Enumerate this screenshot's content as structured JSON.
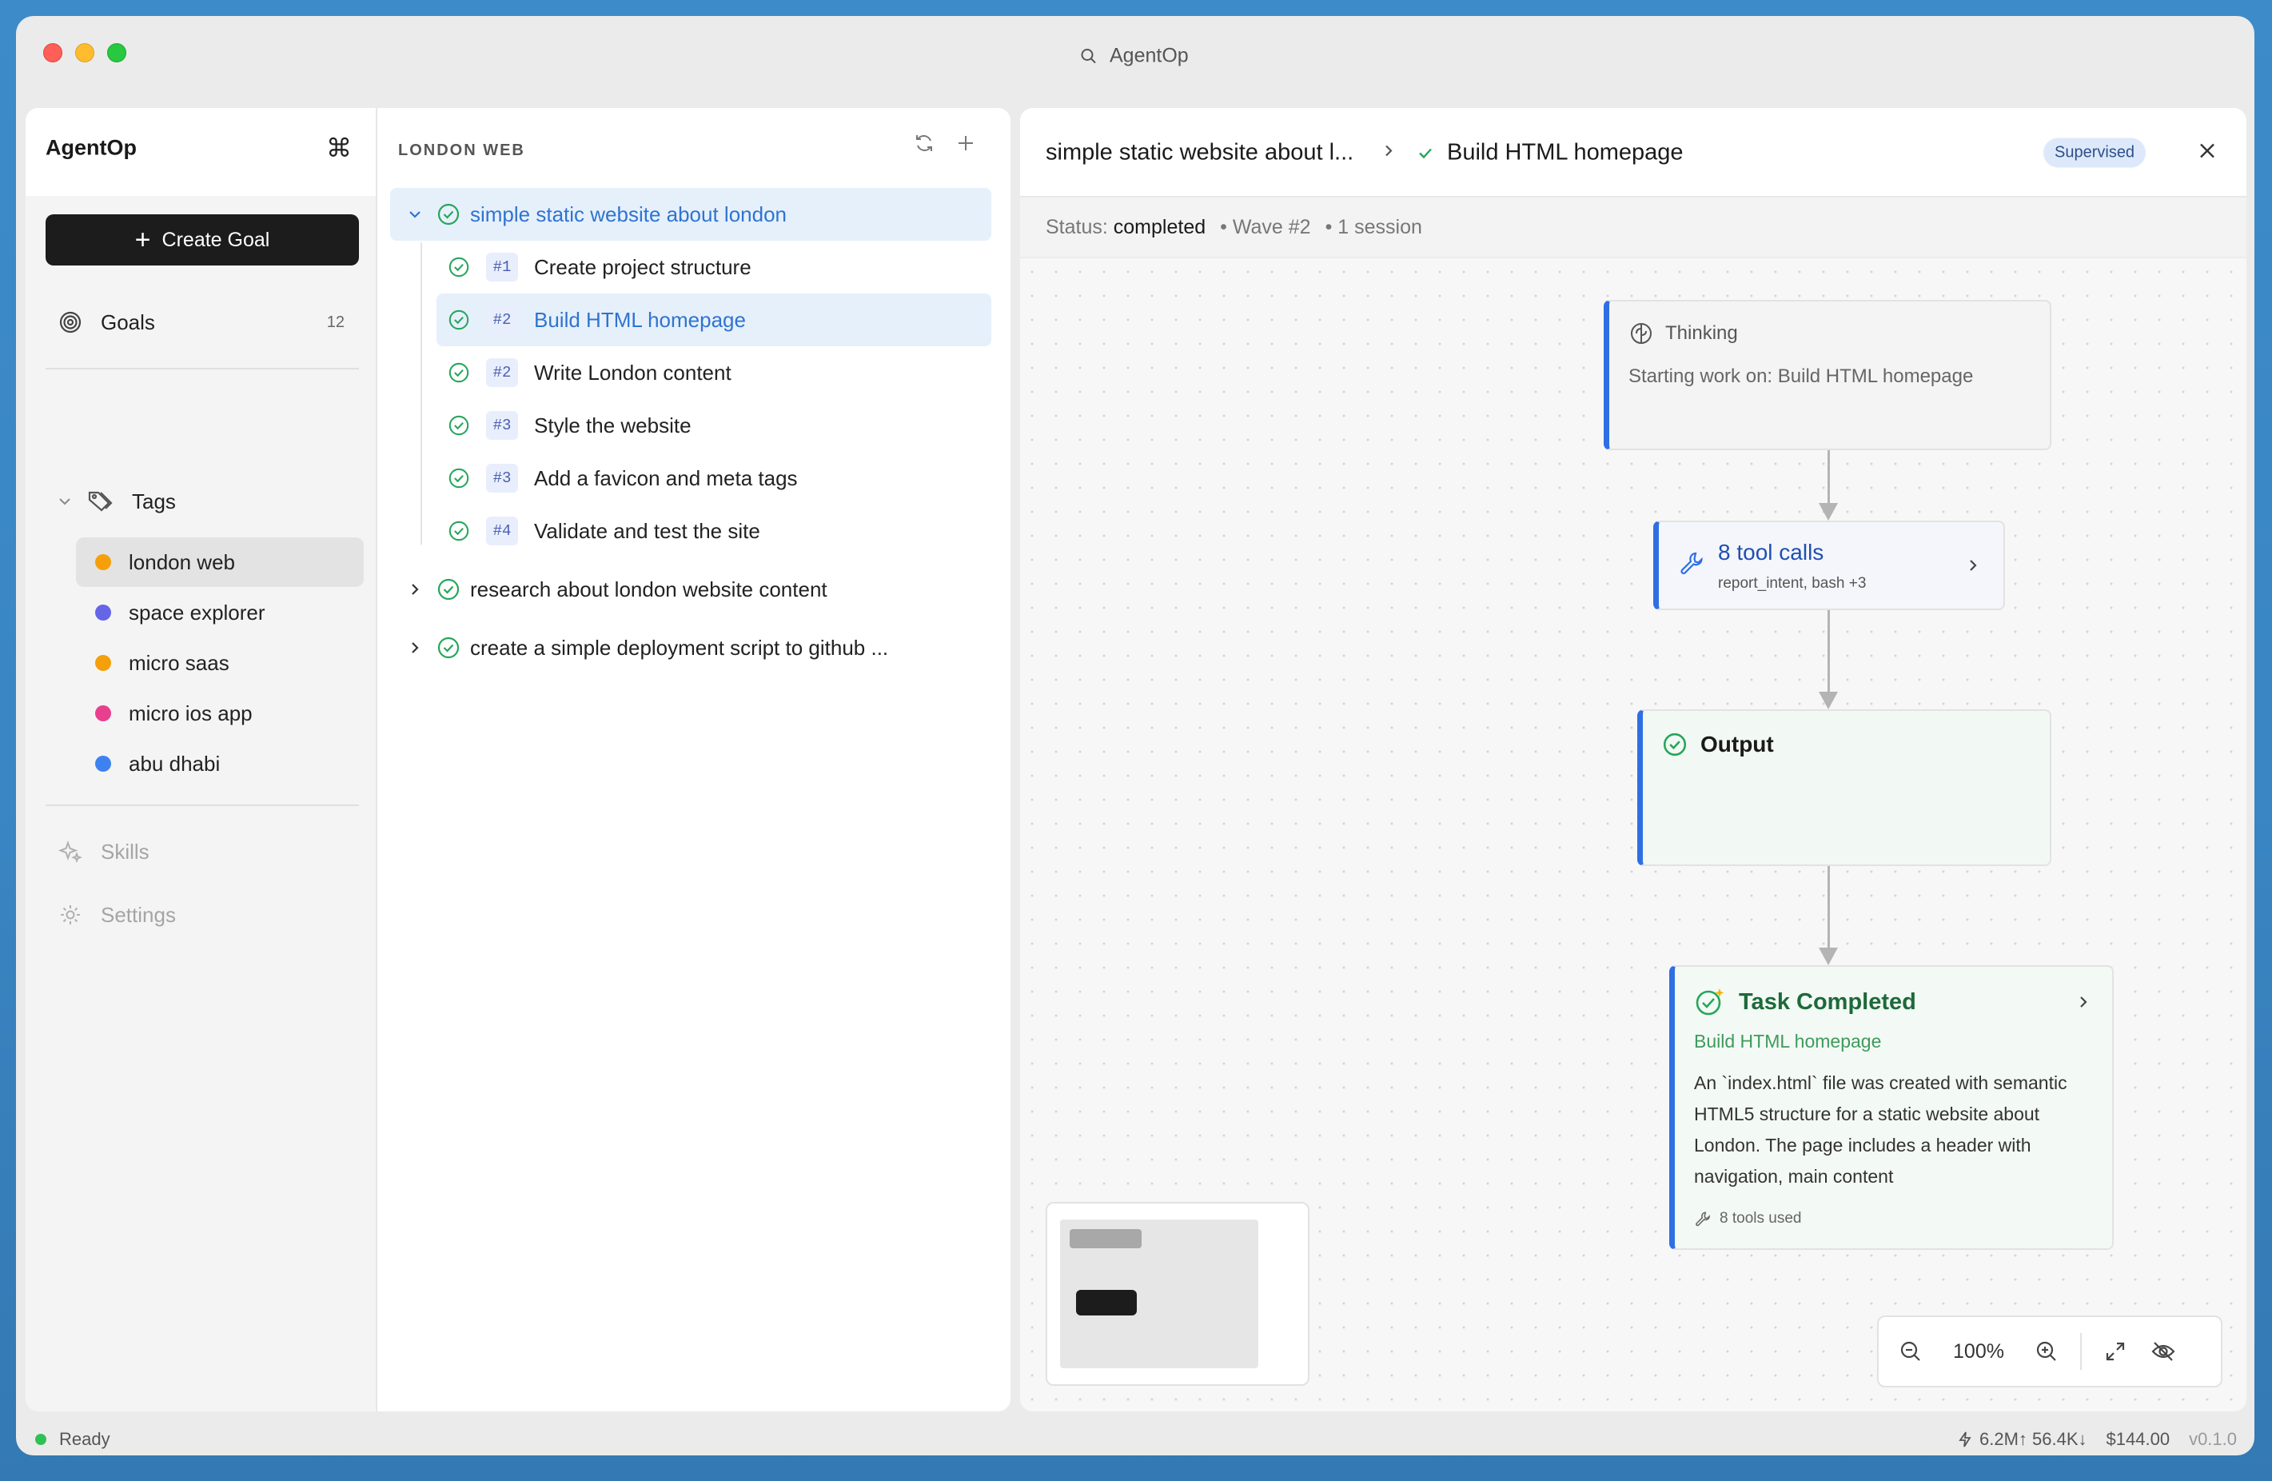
{
  "window": {
    "title": "AgentOp"
  },
  "sidebar": {
    "app_name": "AgentOp",
    "create_label": "Create Goal",
    "goals": {
      "label": "Goals",
      "count": "12"
    },
    "tags_label": "Tags",
    "tags": [
      {
        "label": "london web",
        "color": "#f5a00a",
        "active": true
      },
      {
        "label": "space explorer",
        "color": "#6565e8"
      },
      {
        "label": "micro saas",
        "color": "#f5a00a"
      },
      {
        "label": "micro ios app",
        "color": "#e8408f"
      },
      {
        "label": "abu dhabi",
        "color": "#3d82f0"
      }
    ],
    "skills_label": "Skills",
    "settings_label": "Settings"
  },
  "goals_panel": {
    "section_title": "LONDON WEB",
    "goals": [
      {
        "title": "simple static website about london",
        "expanded": true,
        "tasks": [
          {
            "num": "#1",
            "title": "Create project structure"
          },
          {
            "num": "#2",
            "title": "Build HTML homepage",
            "selected": true
          },
          {
            "num": "#2",
            "title": "Write London content"
          },
          {
            "num": "#3",
            "title": "Style the website"
          },
          {
            "num": "#3",
            "title": "Add a favicon and meta tags"
          },
          {
            "num": "#4",
            "title": "Validate and test the site"
          }
        ]
      },
      {
        "title": "research about london website content",
        "expanded": false
      },
      {
        "title": "create a simple deployment script to github ...",
        "expanded": false
      }
    ]
  },
  "detail": {
    "breadcrumb_goal": "simple static website about l...",
    "breadcrumb_task": "Build HTML homepage",
    "badge": "Supervised",
    "status_label": "Status:",
    "status_value": "completed",
    "wave": "• Wave #2",
    "sessions": "• 1 session",
    "nodes": {
      "thinking": {
        "title": "Thinking",
        "text": "Starting work on: Build HTML homepage"
      },
      "tools": {
        "title": "8 tool calls",
        "subtitle": "report_intent, bash +3"
      },
      "output": {
        "title": "Output"
      },
      "completed": {
        "title": "Task Completed",
        "subtitle": "Build HTML homepage",
        "text": "An `index.html` file was created with semantic HTML5 structure for a static website about London. The page includes a header with navigation, main content",
        "tools_used": "8 tools used"
      }
    },
    "zoom": "100%"
  },
  "footer": {
    "status": "Ready",
    "tokens": "6.2M↑ 56.4K↓",
    "cost": "$144.00",
    "version": "v0.1.0"
  },
  "colors": {
    "accent": "#2f6fe4",
    "success": "#26a65b",
    "brand_dark": "#1c1c1c"
  }
}
